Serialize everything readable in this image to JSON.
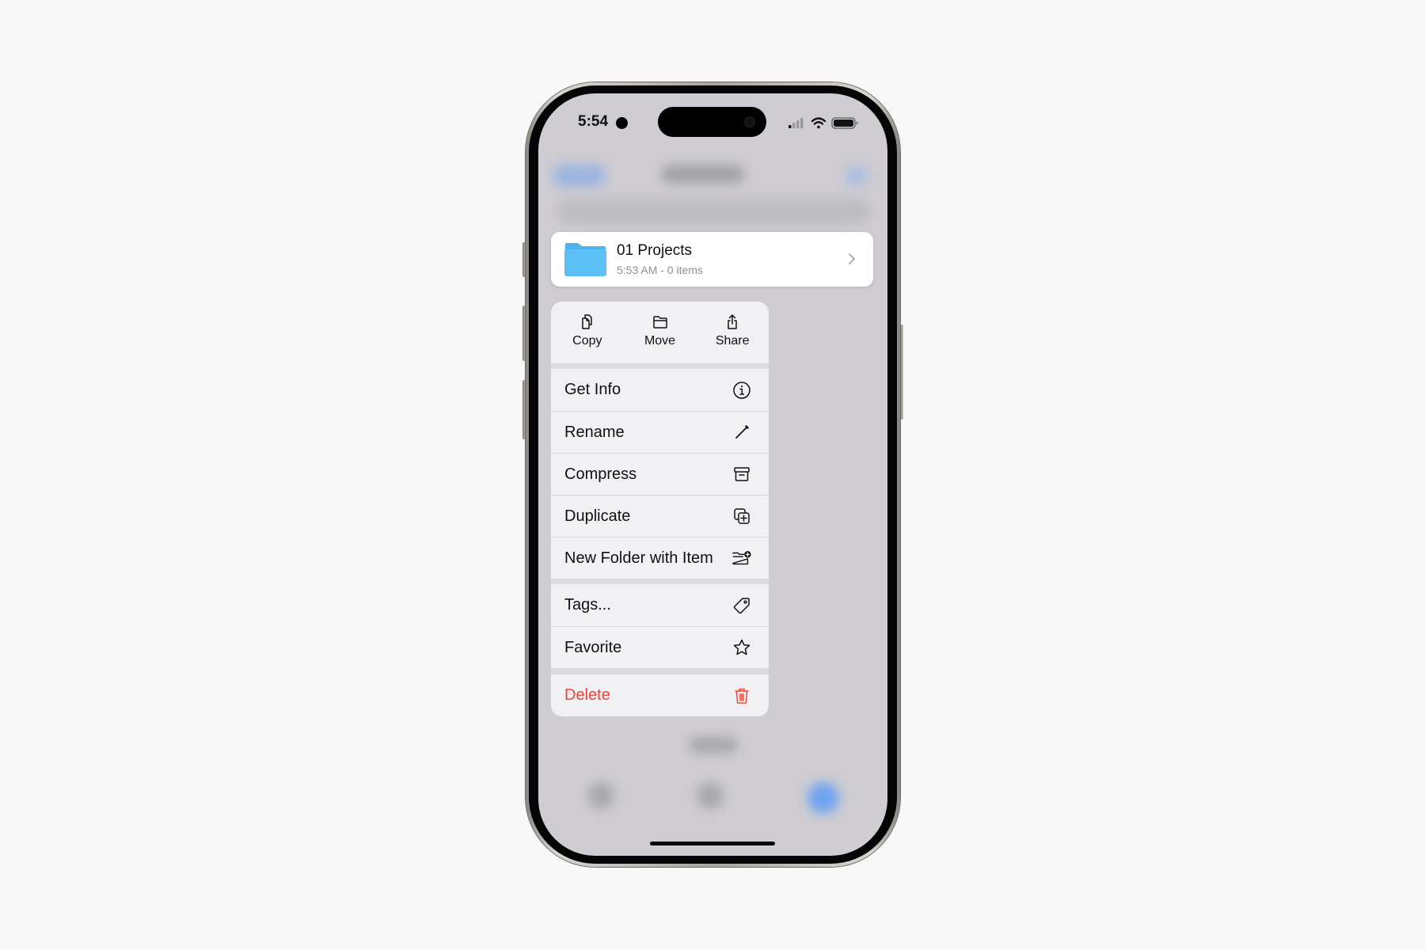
{
  "status_bar": {
    "time": "5:54",
    "icons": [
      "recording-dot-icon",
      "cellular-signal-icon",
      "wifi-icon",
      "battery-icon"
    ]
  },
  "preview": {
    "title": "01 Projects",
    "subtitle": "5:53 AM - 0 items",
    "icon": "folder-icon",
    "accessory": "chevron-right-icon"
  },
  "menu": {
    "top_actions": [
      {
        "label": "Copy",
        "icon": "copy-icon"
      },
      {
        "label": "Move",
        "icon": "folder-icon"
      },
      {
        "label": "Share",
        "icon": "share-icon"
      }
    ],
    "groups": [
      [
        {
          "label": "Get Info",
          "icon": "info-icon"
        },
        {
          "label": "Rename",
          "icon": "pencil-icon"
        },
        {
          "label": "Compress",
          "icon": "archive-box-icon"
        },
        {
          "label": "Duplicate",
          "icon": "duplicate-icon"
        },
        {
          "label": "New Folder with Item",
          "icon": "folder-badge-plus-icon"
        }
      ],
      [
        {
          "label": "Tags...",
          "icon": "tag-icon"
        },
        {
          "label": "Favorite",
          "icon": "star-icon"
        }
      ],
      [
        {
          "label": "Delete",
          "icon": "trash-icon",
          "destructive": true
        }
      ]
    ]
  },
  "colors": {
    "destructive": "#f04438",
    "folder": "#5ac0f5",
    "accent": "#4a9ff5"
  }
}
